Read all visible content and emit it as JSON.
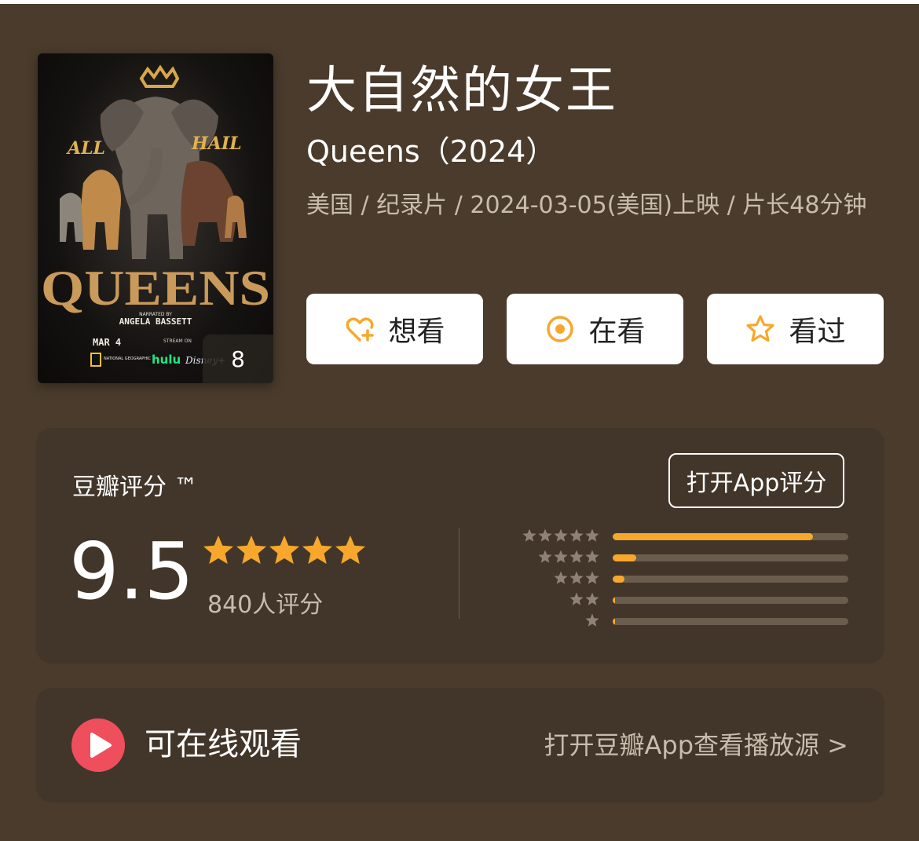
{
  "movie": {
    "title_cn": "大自然的女王",
    "title_en_year": "Queens（2024）",
    "meta": "美国 / 纪录片 / 2024-03-05(美国)上映 / 片长48分钟",
    "poster": {
      "photo_count": "8",
      "texts": {
        "all": "ALL",
        "hail": "HAIL",
        "queens": "QUEENS",
        "narrated_by": "NARRATED BY",
        "narrator": "ANGELA BASSETT",
        "date": "MAR 4",
        "stream_on": "STREAM ON",
        "natgeo": "NATIONAL GEOGRAPHIC",
        "hulu": "hulu",
        "disney": "Disney+"
      }
    }
  },
  "actions": {
    "wish": {
      "label": "想看",
      "icon": "heart-plus-icon"
    },
    "doing": {
      "label": "在看",
      "icon": "target-circle-icon"
    },
    "done": {
      "label": "看过",
      "icon": "star-outline-icon"
    }
  },
  "rating": {
    "label": "豆瓣评分 ™",
    "open_app_button": "打开App评分",
    "score": "9.5",
    "stars": 5,
    "votes": "840人评分",
    "distribution": [
      {
        "stars": 5,
        "fraction": 0.85
      },
      {
        "stars": 4,
        "fraction": 0.1
      },
      {
        "stars": 3,
        "fraction": 0.05
      },
      {
        "stars": 2,
        "fraction": 0.01
      },
      {
        "stars": 1,
        "fraction": 0.01
      }
    ]
  },
  "watch": {
    "label": "可在线观看",
    "link": "打开豆瓣App查看播放源 >",
    "icon": "play-icon"
  },
  "colors": {
    "background": "#4a3b2c",
    "card": "#42362a",
    "star": "#f7a82c",
    "play": "#ef4f5d",
    "muted": "#c8bcae"
  }
}
